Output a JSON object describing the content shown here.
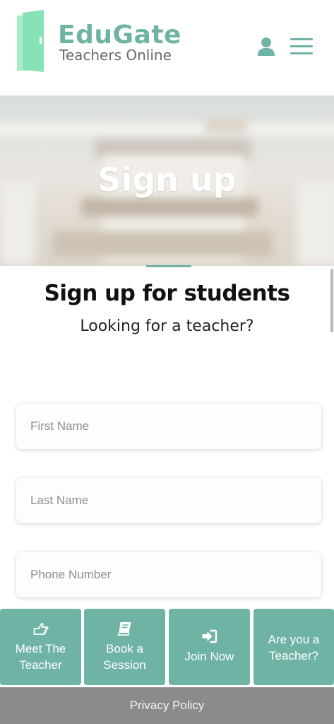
{
  "header": {
    "logo_title": "EduGate",
    "logo_subtitle": "Teachers Online",
    "user_icon": "user-icon",
    "menu_icon": "hamburger-menu-icon"
  },
  "hero": {
    "title": "Sign up"
  },
  "intro": {
    "title": "Sign up for students",
    "subtitle": "Looking for a teacher?"
  },
  "form": {
    "first_name_placeholder": "First Name",
    "last_name_placeholder": "Last Name",
    "phone_placeholder": "Phone Number"
  },
  "bottom_nav": [
    {
      "label": "Meet The\nTeacher",
      "icon": "hand-point-icon"
    },
    {
      "label": "Book a\nSession",
      "icon": "book-icon"
    },
    {
      "label": "Join Now",
      "icon": "sign-in-icon"
    },
    {
      "label": "Are you a\nTeacher?",
      "icon": ""
    }
  ],
  "footer": {
    "privacy_label": "Privacy Policy"
  },
  "colors": {
    "accent": "#6fb3a5",
    "footer_bg": "#8b8b8b",
    "logo_subtitle": "#6a6a6a"
  }
}
